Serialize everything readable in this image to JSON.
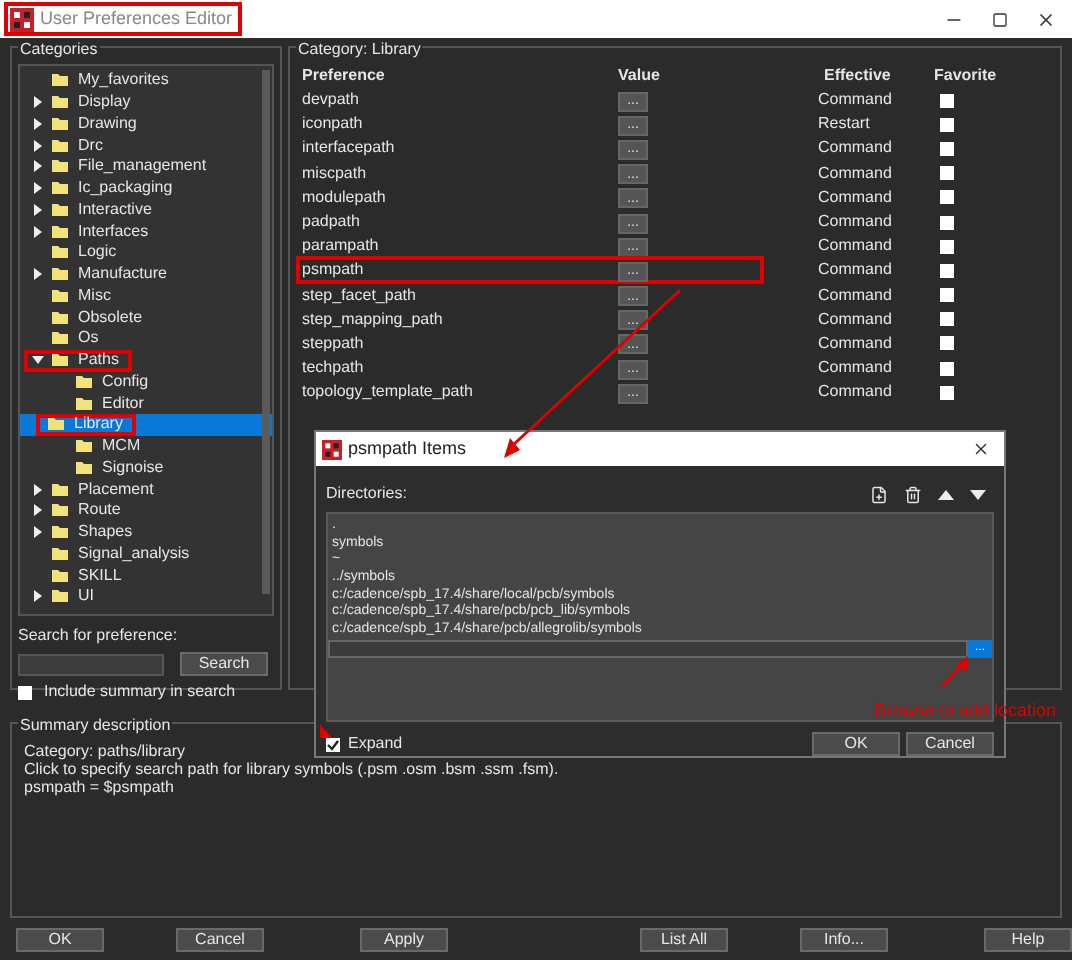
{
  "window": {
    "title": "User Preferences Editor"
  },
  "categories": {
    "title": "Categories",
    "tree": [
      {
        "label": "My_favorites",
        "kind": "leaf",
        "selected": false
      },
      {
        "label": "Display",
        "kind": "branch",
        "expanded": false,
        "selected": false
      },
      {
        "label": "Drawing",
        "kind": "branch",
        "expanded": false,
        "selected": false
      },
      {
        "label": "Drc",
        "kind": "branch",
        "expanded": false,
        "selected": false
      },
      {
        "label": "File_management",
        "kind": "branch",
        "expanded": false,
        "selected": false
      },
      {
        "label": "Ic_packaging",
        "kind": "branch",
        "expanded": false,
        "selected": false
      },
      {
        "label": "Interactive",
        "kind": "branch",
        "expanded": false,
        "selected": false
      },
      {
        "label": "Interfaces",
        "kind": "branch",
        "expanded": false,
        "selected": false
      },
      {
        "label": "Logic",
        "kind": "leaf",
        "selected": false
      },
      {
        "label": "Manufacture",
        "kind": "branch",
        "expanded": false,
        "selected": false
      },
      {
        "label": "Misc",
        "kind": "leaf",
        "selected": false
      },
      {
        "label": "Obsolete",
        "kind": "leaf",
        "selected": false
      },
      {
        "label": "Os",
        "kind": "leaf",
        "selected": false
      },
      {
        "label": "Paths",
        "kind": "branch",
        "expanded": true,
        "selected": false,
        "children": [
          {
            "label": "Config",
            "kind": "leaf",
            "selected": false
          },
          {
            "label": "Editor",
            "kind": "leaf",
            "selected": false
          },
          {
            "label": "Library",
            "kind": "leaf",
            "selected": true
          },
          {
            "label": "MCM",
            "kind": "leaf",
            "selected": false
          },
          {
            "label": "Signoise",
            "kind": "leaf",
            "selected": false
          }
        ]
      },
      {
        "label": "Placement",
        "kind": "branch",
        "expanded": false,
        "selected": false
      },
      {
        "label": "Route",
        "kind": "branch",
        "expanded": false,
        "selected": false
      },
      {
        "label": "Shapes",
        "kind": "branch",
        "expanded": false,
        "selected": false
      },
      {
        "label": "Signal_analysis",
        "kind": "leaf",
        "selected": false
      },
      {
        "label": "SKILL",
        "kind": "leaf",
        "selected": false
      },
      {
        "label": "UI",
        "kind": "branch",
        "expanded": false,
        "selected": false
      }
    ],
    "search_label": "Search for preference:",
    "search_button": "Search",
    "include_summary": {
      "label": "Include summary in search",
      "checked": false
    }
  },
  "category": {
    "label": "Category:",
    "value": "Library",
    "columns": [
      "Preference",
      "Value",
      "Effective",
      "Favorite"
    ],
    "rows": [
      {
        "name": "devpath",
        "value": "...",
        "effective": "Command",
        "favorite": false
      },
      {
        "name": "iconpath",
        "value": "...",
        "effective": "Restart",
        "favorite": false
      },
      {
        "name": "interfacepath",
        "value": "...",
        "effective": "Command",
        "favorite": false
      },
      {
        "name": "miscpath",
        "value": "...",
        "effective": "Command",
        "favorite": false
      },
      {
        "name": "modulepath",
        "value": "...",
        "effective": "Command",
        "favorite": false
      },
      {
        "name": "padpath",
        "value": "...",
        "effective": "Command",
        "favorite": false
      },
      {
        "name": "parampath",
        "value": "...",
        "effective": "Command",
        "favorite": false
      },
      {
        "name": "psmpath",
        "value": "...",
        "effective": "Command",
        "favorite": false
      },
      {
        "name": "step_facet_path",
        "value": "...",
        "effective": "Command",
        "favorite": false
      },
      {
        "name": "step_mapping_path",
        "value": "...",
        "effective": "Command",
        "favorite": false
      },
      {
        "name": "steppath",
        "value": "...",
        "effective": "Command",
        "favorite": false
      },
      {
        "name": "techpath",
        "value": "...",
        "effective": "Command",
        "favorite": false
      },
      {
        "name": "topology_template_path",
        "value": "...",
        "effective": "Command",
        "favorite": false
      }
    ]
  },
  "summary": {
    "title": "Summary description",
    "lines": [
      "Category: paths/library",
      "Click to specify search path for library symbols (.psm .osm .bsm .ssm .fsm).",
      "psmpath = $psmpath"
    ]
  },
  "buttons": [
    "OK",
    "Cancel",
    "Apply",
    "List All",
    "Info...",
    "Help"
  ],
  "dialog": {
    "title": "psmpath Items",
    "label": "Directories:",
    "items": [
      ".",
      "symbols",
      "~",
      "../symbols",
      "c:/cadence/spb_17.4/share/local/pcb/symbols",
      "c:/cadence/spb_17.4/share/pcb/pcb_lib/symbols",
      "c:/cadence/spb_17.4/share/pcb/allegrolib/symbols"
    ],
    "browse_button": "...",
    "expand": {
      "label": "Expand",
      "checked": true
    },
    "buttons": [
      "OK",
      "Cancel"
    ]
  },
  "annotation": {
    "text": "Browse to add location"
  }
}
